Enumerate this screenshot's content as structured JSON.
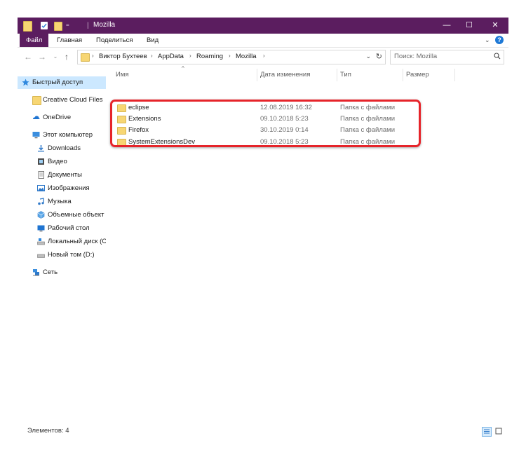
{
  "colors": {
    "title_bg": "#5b1d5f",
    "selected_bg": "#cce8ff",
    "highlight": "#e6242a"
  },
  "window": {
    "title": "Mozilla",
    "qat_separator": "=",
    "controls": [
      "—",
      "☐",
      "✕"
    ]
  },
  "ribbon": {
    "tabs": [
      "Файл",
      "Главная",
      "Поделиться",
      "Вид"
    ],
    "expand_icon": "chevron-down-icon",
    "help_icon": "?"
  },
  "address_bar": {
    "path": [
      "Виктор Бухтеев",
      "AppData",
      "Roaming",
      "Mozilla"
    ]
  },
  "search": {
    "placeholder": "Поиск: Mozilla"
  },
  "nav_pane": {
    "items": [
      {
        "label": "Быстрый доступ",
        "icon": "star-icon",
        "selected": true
      },
      {
        "label": "Creative Cloud Files",
        "icon": "creative-cloud-icon"
      },
      {
        "label": "OneDrive",
        "icon": "onedrive-icon"
      },
      {
        "label": "Этот компьютер",
        "icon": "computer-icon"
      },
      {
        "label": "Downloads",
        "icon": "downloads-icon"
      },
      {
        "label": "Видео",
        "icon": "video-icon"
      },
      {
        "label": "Документы",
        "icon": "documents-icon"
      },
      {
        "label": "Изображения",
        "icon": "pictures-icon"
      },
      {
        "label": "Музыка",
        "icon": "music-icon"
      },
      {
        "label": "Объемные объект",
        "icon": "3d-objects-icon"
      },
      {
        "label": "Рабочий стол",
        "icon": "desktop-icon"
      },
      {
        "label": "Локальный диск (С",
        "icon": "local-disk-icon"
      },
      {
        "label": "Новый том (D:)",
        "icon": "drive-icon"
      },
      {
        "label": "Сеть",
        "icon": "network-icon"
      }
    ]
  },
  "columns": [
    "Имя",
    "Дата изменения",
    "Тип",
    "Размер"
  ],
  "files": [
    {
      "name": "eclipse",
      "date": "12.08.2019 16:32",
      "type": "Папка с файлами"
    },
    {
      "name": "Extensions",
      "date": "09.10.2018 5:23",
      "type": "Папка с файлами"
    },
    {
      "name": "Firefox",
      "date": "30.10.2019 0:14",
      "type": "Папка с файлами"
    },
    {
      "name": "SystemExtensionsDev",
      "date": "09.10.2018 5:23",
      "type": "Папка с файлами"
    }
  ],
  "status": {
    "count_text": "Элементов: 4"
  }
}
